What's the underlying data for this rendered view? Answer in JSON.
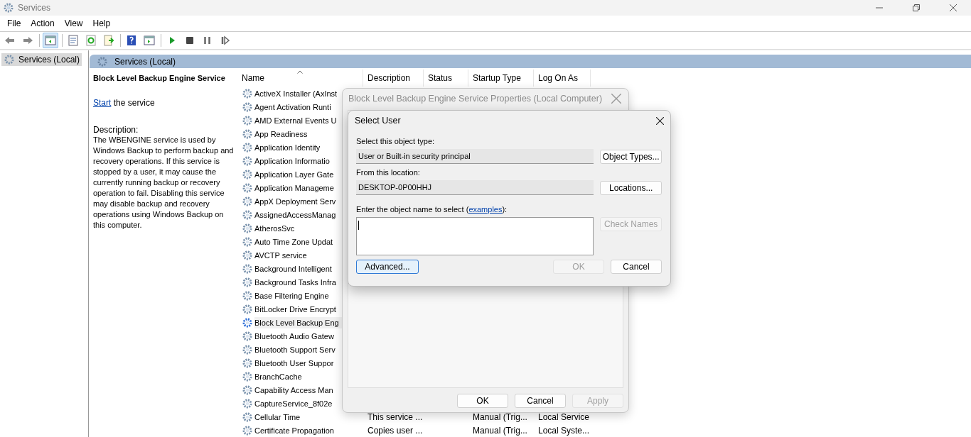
{
  "window": {
    "title": "Services"
  },
  "menu": [
    "File",
    "Action",
    "View",
    "Help"
  ],
  "toolbar": [
    [
      {
        "kind": "back",
        "pressed": false
      },
      {
        "kind": "forward",
        "pressed": false
      }
    ],
    [
      {
        "kind": "console-tree",
        "pressed": true
      }
    ],
    [
      {
        "kind": "properties",
        "pressed": false
      },
      {
        "kind": "refresh",
        "pressed": false
      },
      {
        "kind": "export",
        "pressed": false
      }
    ],
    [
      {
        "kind": "help",
        "pressed": false
      },
      {
        "kind": "action-pane",
        "pressed": false
      }
    ],
    [
      {
        "kind": "start",
        "pressed": false
      },
      {
        "kind": "stop",
        "pressed": false
      },
      {
        "kind": "pause",
        "pressed": false
      },
      {
        "kind": "resume",
        "pressed": false
      }
    ]
  ],
  "tree": [
    {
      "label": "Services (Local)",
      "selected": true
    }
  ],
  "pane_header": "Services (Local)",
  "details": {
    "title": "Block Level Backup Engine Service",
    "start_link": "Start",
    "start_text": "the service",
    "description_label": "Description:",
    "description": "The WBENGINE service is used by Windows Backup to perform backup and recovery operations. If this service is stopped by a user, it may cause the currently running backup or recovery operation to fail. Disabling this service may disable backup and recovery operations using Windows Backup on this computer."
  },
  "table": {
    "columns": [
      {
        "label": "Name",
        "sorted": true
      },
      {
        "label": "Description",
        "sorted": false
      },
      {
        "label": "Status",
        "sorted": false
      },
      {
        "label": "Startup Type",
        "sorted": false
      },
      {
        "label": "Log On As",
        "sorted": false
      }
    ],
    "rows": [
      {
        "name": "ActiveX Installer (AxInst",
        "selected": false
      },
      {
        "name": "Agent Activation Runti",
        "selected": false
      },
      {
        "name": "AMD External Events U",
        "selected": false
      },
      {
        "name": "App Readiness",
        "selected": false
      },
      {
        "name": "Application Identity",
        "selected": false
      },
      {
        "name": "Application Informatio",
        "selected": false
      },
      {
        "name": "Application Layer Gate",
        "selected": false
      },
      {
        "name": "Application Manageme",
        "selected": false
      },
      {
        "name": "AppX Deployment Serv",
        "selected": false
      },
      {
        "name": "AssignedAccessManag",
        "selected": false
      },
      {
        "name": "AtherosSvc",
        "selected": false
      },
      {
        "name": "Auto Time Zone Updat",
        "selected": false
      },
      {
        "name": "AVCTP service",
        "selected": false
      },
      {
        "name": "Background Intelligent",
        "selected": false
      },
      {
        "name": "Background Tasks Infra",
        "selected": false
      },
      {
        "name": "Base Filtering Engine",
        "selected": false
      },
      {
        "name": "BitLocker Drive Encrypt",
        "selected": false
      },
      {
        "name": "Block Level Backup Eng",
        "selected": true
      },
      {
        "name": "Bluetooth Audio Gatew",
        "selected": false
      },
      {
        "name": "Bluetooth Support Serv",
        "selected": false
      },
      {
        "name": "Bluetooth User Suppor",
        "selected": false
      },
      {
        "name": "BranchCache",
        "selected": false
      },
      {
        "name": "Capability Access Man",
        "selected": false
      },
      {
        "name": "CaptureService_8f02e",
        "selected": false
      },
      {
        "name": "Cellular Time",
        "description": "This service ...",
        "startup_type": "Manual (Trig...",
        "log_on_as": "Local Service",
        "selected": false
      },
      {
        "name": "Certificate Propagation",
        "description": "Copies user ...",
        "startup_type": "Manual (Trig...",
        "log_on_as": "Local Syste...",
        "selected": false
      }
    ]
  },
  "properties_dialog": {
    "title": "Block Level Backup Engine Service Properties (Local Computer)",
    "active": false,
    "buttons": [
      {
        "label": "OK",
        "disabled": false
      },
      {
        "label": "Cancel",
        "disabled": false
      },
      {
        "label": "Apply",
        "disabled": true
      }
    ]
  },
  "select_user_dialog": {
    "title": "Select User",
    "object_type_label": "Select this object type:",
    "object_type_value": "User or Built-in security principal",
    "object_types_button": "Object Types...",
    "location_label": "From this location:",
    "location_value": "DESKTOP-0P00HHJ",
    "locations_button": "Locations...",
    "name_label_before": "Enter the object name to select (",
    "name_link": "examples",
    "name_label_after": "):",
    "check_names": {
      "label": "Check Names",
      "disabled": true
    },
    "advanced": {
      "label": "Advanced...",
      "focused": true
    },
    "ok": {
      "label": "OK",
      "disabled": true
    },
    "cancel": {
      "label": "Cancel",
      "disabled": false
    }
  }
}
